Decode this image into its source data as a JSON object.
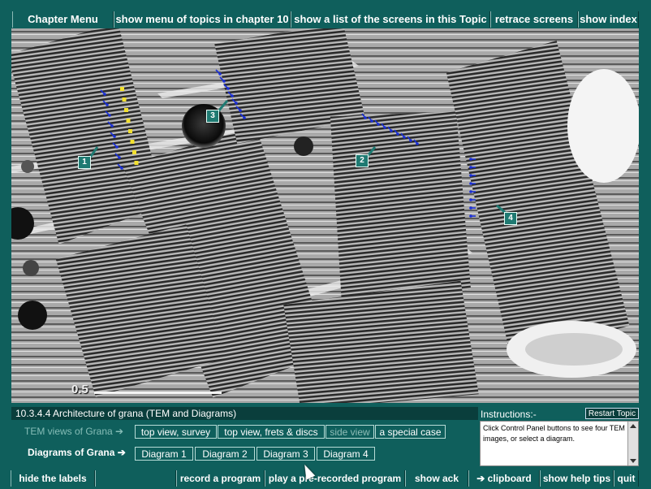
{
  "colors": {
    "background": "#0f5f5c",
    "title_strip": "#0a3e3c",
    "annotation_arrow_blue": "#1a2fd6",
    "annotation_arrow_yellow": "#f2e030",
    "marker_fill": "#1f7a72"
  },
  "top_menu": {
    "chapter_menu": "Chapter Menu",
    "show_topics": "show  menu of topics in  chapter  10",
    "show_screens": "show a list of the screens in this Topic",
    "retrace": "retrace  screens",
    "show_index": "show  index"
  },
  "image": {
    "markers": [
      "1",
      "2",
      "3",
      "4"
    ],
    "scale_bar_label": "0.5"
  },
  "panel": {
    "topic_title": "10.3.4.4  Architecture of grana (TEM and Diagrams)",
    "tem_row_label": "TEM views of Grana ➔",
    "tem_buttons": [
      "top view, survey",
      "top view, frets & discs",
      "side view",
      "a special case"
    ],
    "diagram_row_label": "Diagrams of Grana ➔",
    "diagram_buttons": [
      "Diagram 1",
      "Diagram 2",
      "Diagram 3",
      "Diagram 4"
    ],
    "instructions_label": "Instructions:-",
    "restart_label": "Restart Topic",
    "instructions_text": "Click Control Panel buttons to see four TEM images, or select a diagram."
  },
  "bottom_menu": {
    "hide_labels": "hide  the labels",
    "record": "record a program",
    "play": "play a pre-recorded program",
    "show_ack": "show ack",
    "clipboard": "➔ clipboard",
    "help_tips": "show help tips",
    "quit": "quit"
  }
}
